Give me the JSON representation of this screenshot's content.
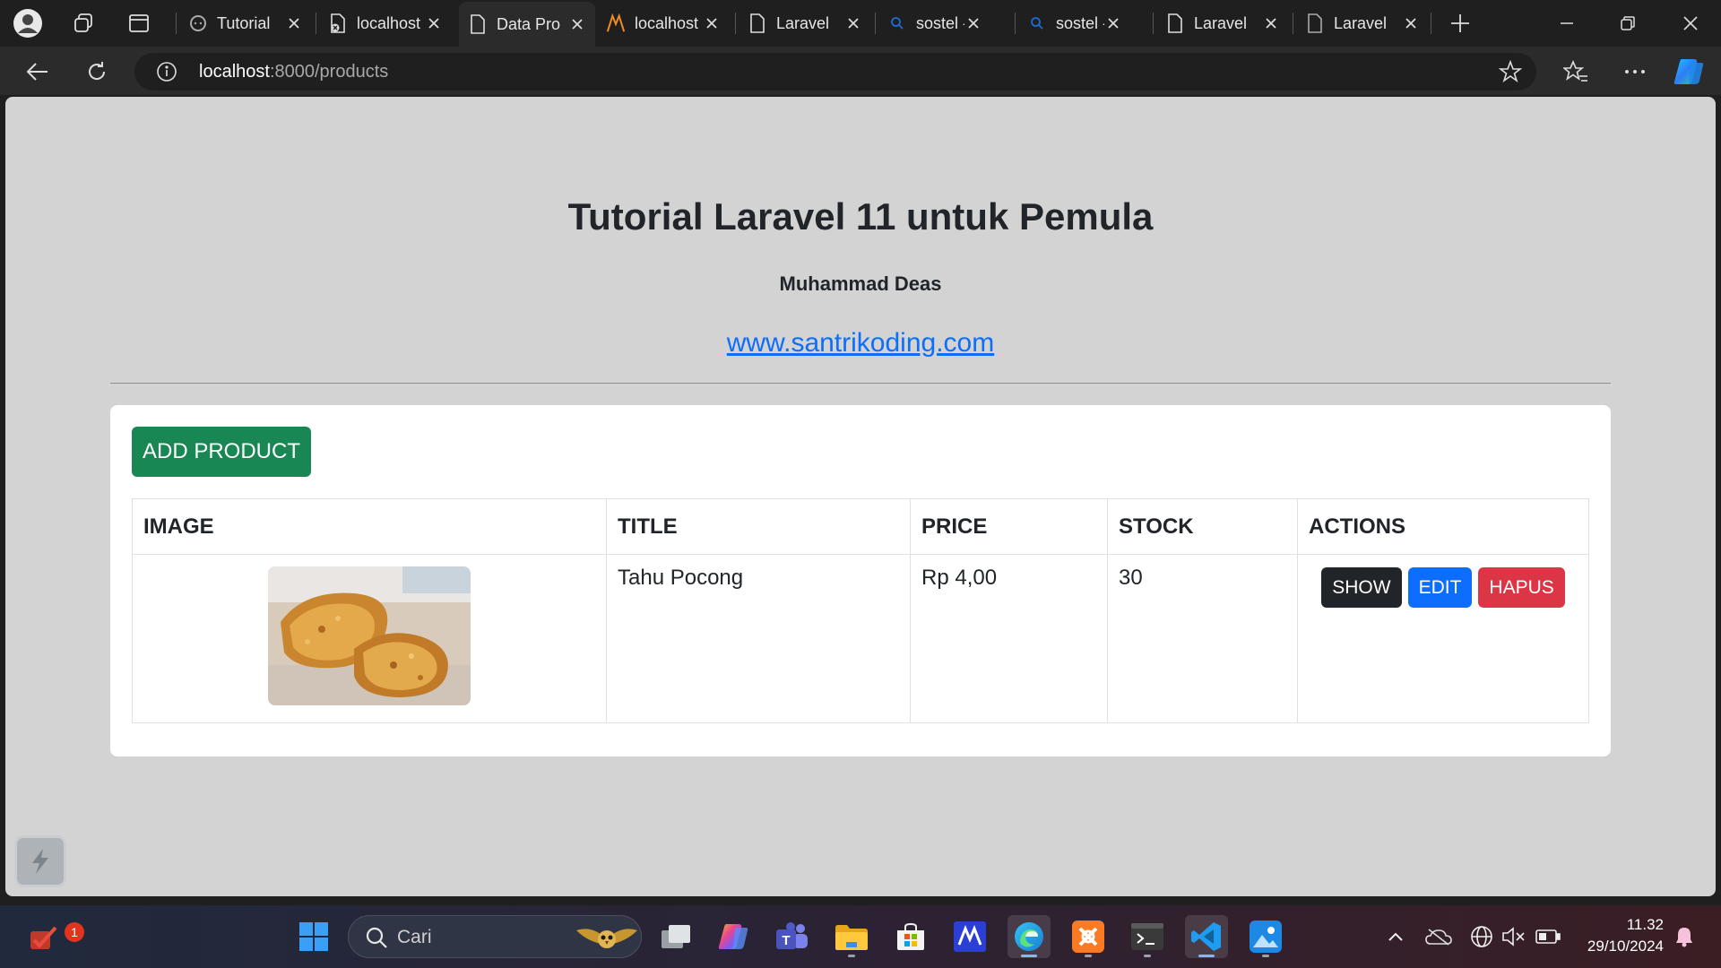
{
  "browser": {
    "tabs": [
      {
        "title": "Tutorial",
        "icon": "chat-icon"
      },
      {
        "title": "localhost",
        "icon": "page-error-icon"
      },
      {
        "title": "Data Pro",
        "icon": "page-icon"
      },
      {
        "title": "localhost",
        "icon": "xampp-icon"
      },
      {
        "title": "Laravel",
        "icon": "page-icon"
      },
      {
        "title": "sostel -",
        "icon": "search-icon"
      },
      {
        "title": "sostel -",
        "icon": "search-icon"
      },
      {
        "title": "Laravel",
        "icon": "page-icon"
      },
      {
        "title": "Laravel",
        "icon": "page-icon"
      }
    ],
    "address": {
      "host": "localhost",
      "path": ":8000/products"
    }
  },
  "page": {
    "title": "Tutorial Laravel 11 untuk Pemula",
    "author": "Muhammad Deas",
    "link": "www.santrikoding.com",
    "add_button": "ADD PRODUCT",
    "table": {
      "headers": [
        "IMAGE",
        "TITLE",
        "PRICE",
        "STOCK",
        "ACTIONS"
      ],
      "rows": [
        {
          "title": "Tahu Pocong",
          "price": "Rp 4,00",
          "stock": "30",
          "actions": {
            "show": "SHOW",
            "edit": "EDIT",
            "delete": "HAPUS"
          }
        }
      ]
    }
  },
  "taskbar": {
    "search_placeholder": "Cari",
    "notification_badge": "1",
    "time": "11.32",
    "date": "29/10/2024"
  },
  "colors": {
    "success": "#198754",
    "primary": "#0d6efd",
    "danger": "#dc3545",
    "dark": "#212529",
    "page_bg": "#d3d3d3"
  }
}
